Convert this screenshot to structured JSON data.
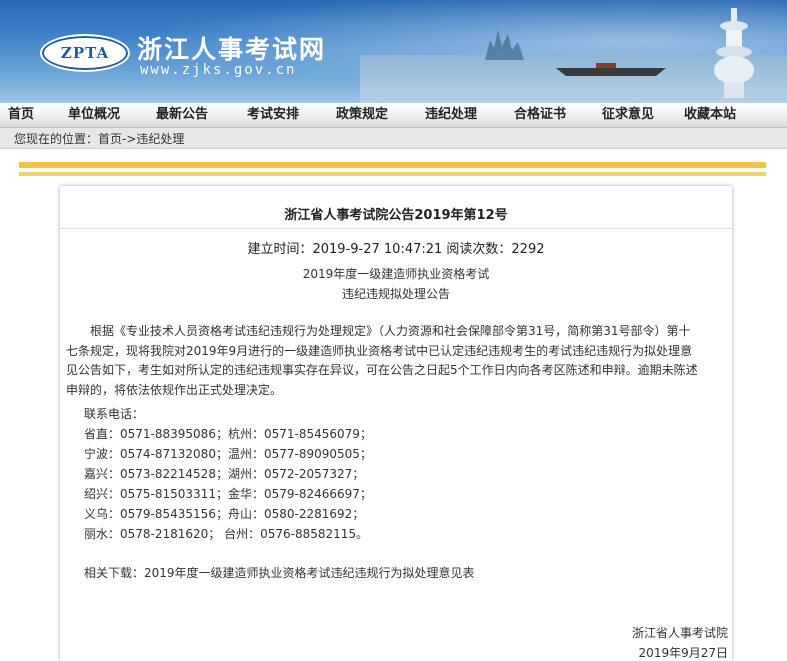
{
  "header": {
    "logo_text": "ZPTA",
    "site_name": "浙江人事考试网",
    "site_url": "www.zjks.gov.cn"
  },
  "nav": {
    "items": [
      "首页",
      "单位概况",
      "最新公告",
      "考试安排",
      "政策规定",
      "违纪处理",
      "合格证书",
      "征求意见",
      "收藏本站"
    ]
  },
  "breadcrumb": {
    "prefix": "您现在的位置：",
    "home": "首页",
    "arrow": "->",
    "current": "违纪处理"
  },
  "article": {
    "title": "浙江省人事考试院公告2019年第12号",
    "meta": "建立时间：2019-9-27 10:47:21 阅读次数：2292",
    "subtitle_1": "2019年度一级建造师执业资格考试",
    "subtitle_2": "违纪违规拟处理公告",
    "paragraph": "根据《专业技术人员资格考试违纪违规行为处理规定》（人力资源和社会保障部令第31号，简称第31号部令）第十七条规定，现将我院对2019年9月进行的一级建造师执业资格考试中已认定违纪违规考生的考试违纪违规行为拟处理意见公告如下，考生如对所认定的违纪违规事实存在异议，可在公告之日起5个工作日内向各考区陈述和申辩。逾期未陈述申辩的，将依法依规作出正式处理决定。",
    "contact_label": "联系电话：",
    "contacts": [
      "省直：0571-88395086；杭州：0571-85456079；",
      "宁波：0574-87132080；温州：0577-89090505；",
      "嘉兴：0573-82214528；湖州：0572-2057327；",
      "绍兴：0575-81503311；金华：0579-82466697；",
      "义乌：0579-85435156；舟山：0580-2281692；",
      "丽水：0578-2181620； 台州：0576-88582115。"
    ],
    "download_label": "相关下载：",
    "download_link": "2019年度一级建造师执业资格考试违纪违规行为拟处理意见表",
    "signature": "浙江省人事考试院",
    "date": "2019年9月27日"
  },
  "colors": {
    "banner_blue": "#2a6ab4",
    "gold_bar": "#f0c542",
    "nav_bg": "#ededed"
  }
}
